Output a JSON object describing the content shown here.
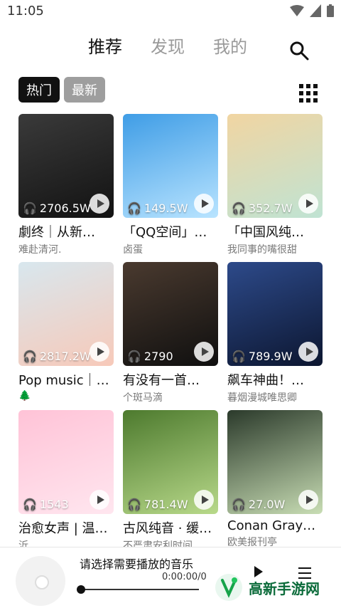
{
  "status": {
    "time": "11:05"
  },
  "tabs": [
    {
      "label": "推荐",
      "active": true
    },
    {
      "label": "发现",
      "active": false
    },
    {
      "label": "我的",
      "active": false
    }
  ],
  "filters": [
    {
      "label": "热门",
      "active": true
    },
    {
      "label": "最新",
      "active": false
    }
  ],
  "playlists": [
    {
      "plays": "2706.5W",
      "title": "劇终｜从新…",
      "subtitle": "难赴清河.",
      "cover": [
        "#3a3a3a",
        "#121212"
      ]
    },
    {
      "plays": "149.5W",
      "title": "「QQ空间」…",
      "subtitle": "卤蛋",
      "cover": [
        "#3f9de6",
        "#b9e4ff"
      ]
    },
    {
      "plays": "352.7W",
      "title": "「中国风纯…",
      "subtitle": "我同事的嘴很甜",
      "cover": [
        "#f1d5a2",
        "#bfe3d3"
      ]
    },
    {
      "plays": "2817.2W",
      "title": "Pop music｜…",
      "subtitle": "🌲",
      "cover": [
        "#d8e7ee",
        "#f7c9b9"
      ]
    },
    {
      "plays": "2790",
      "title": "有没有一首…",
      "subtitle": "个斑马滴",
      "cover": [
        "#4a3a2f",
        "#0f0f0f"
      ]
    },
    {
      "plays": "789.9W",
      "title": "飙车神曲！…",
      "subtitle": "暮烟漫城唯思卿",
      "cover": [
        "#2d4a8a",
        "#0c1630"
      ]
    },
    {
      "plays": "1543",
      "title": "治愈女声 | 温…",
      "subtitle": "沂",
      "cover": [
        "#ffc3d7",
        "#ffe6ef"
      ]
    },
    {
      "plays": "781.4W",
      "title": "古风纯音 · 缓…",
      "subtitle": "不严肃安利时间",
      "cover": [
        "#4d7a2e",
        "#b8d98a"
      ]
    },
    {
      "plays": "27.0W",
      "title": "Conan Gray…",
      "subtitle": "欧美报刊亭",
      "cover": [
        "#2b3a2b",
        "#c8ddb4"
      ]
    }
  ],
  "player": {
    "title": "请选择需要播放的音乐",
    "time": "0:00:00/0",
    "progress": 0
  },
  "watermark": {
    "text": "高新手游网"
  }
}
